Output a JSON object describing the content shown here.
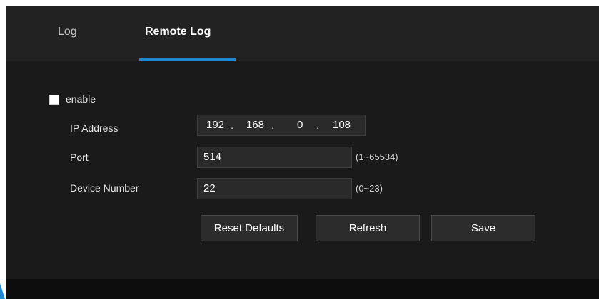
{
  "tabs": {
    "log": "Log",
    "remote_log": "Remote Log",
    "active": "remote_log"
  },
  "form": {
    "enable_label": "enable",
    "enable_checked": false,
    "ip_label": "IP Address",
    "ip": {
      "octet1": "192",
      "octet2": "168",
      "octet3": "0",
      "octet4": "108",
      "sep": "."
    },
    "port_label": "Port",
    "port_value": "514",
    "port_range": "(1~65534)",
    "device_label": "Device Number",
    "device_value": "22",
    "device_range": "(0~23)"
  },
  "buttons": {
    "reset": "Reset Defaults",
    "refresh": "Refresh",
    "save": "Save"
  },
  "colors": {
    "accent": "#1e88d2",
    "panel_bg": "#1a1a1a",
    "tab_bar_bg": "#222222"
  }
}
